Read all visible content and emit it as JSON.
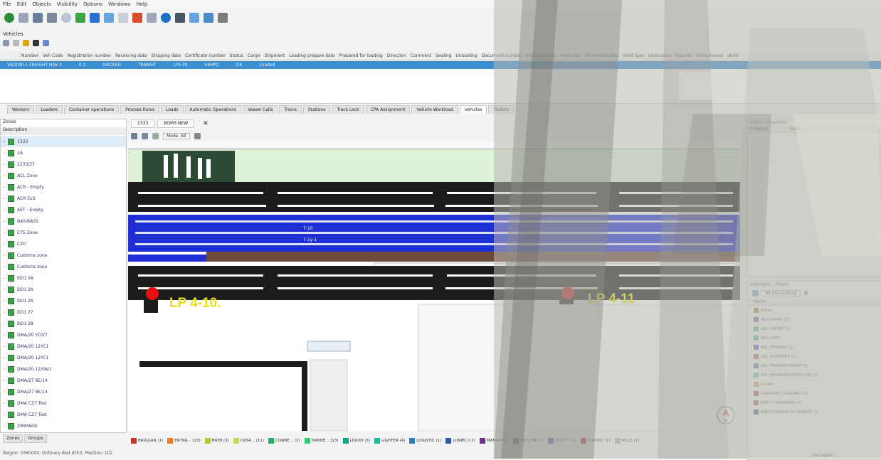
{
  "menu": [
    "File",
    "Edit",
    "Objects",
    "Visibility",
    "Options",
    "Windows",
    "Help"
  ],
  "vehicles": {
    "title": "Vehicles",
    "columns": [
      "Number",
      "Veh Code",
      "Registration number",
      "Receiving date",
      "Shipping date",
      "Certificate number",
      "Status",
      "Cargo",
      "Shipment",
      "Loading prepare date",
      "Prepared for loading",
      "Direction",
      "Comment",
      "Sealing",
      "Unloading",
      "Document number",
      "Hold intention",
      "Hold user",
      "Permission date",
      "Hold type",
      "Instruction",
      "Reports",
      "Performance",
      "Ident"
    ],
    "selected_row": [
      "VAGON11 FREIGHT HSK-3",
      "0.2",
      "DOCKED",
      "TRANSIT",
      "LPS Fit",
      "VIHIPO",
      "OK",
      "Loaded"
    ]
  },
  "tabs": [
    "Workers",
    "Loaders",
    "Container operations",
    "Process Rules",
    "Loads",
    "Automatic Operations",
    "Vessel Calls",
    "Trains",
    "Stations",
    "Track Lock",
    "CPA Assignment",
    "Vehicle Workload",
    "Vehicles",
    "Trailers"
  ],
  "zones": {
    "title": "Zones",
    "desc": "Description",
    "items": [
      "1333",
      "2A",
      "2233/27",
      "ACL Zone",
      "ACR - Empty",
      "ACR Exit",
      "AET - Empty",
      "BAS-BASS",
      "CTS Zone",
      "CZ0",
      "Customs zone",
      "Customs zone",
      "DD1 5A",
      "DD1 26",
      "DD1 26",
      "DD1 27",
      "DD1 28",
      "DMA/20 YC0/7",
      "DMA/20 12YC1",
      "DMA/20 12YC1",
      "DMA/20 12/0A/1",
      "DMA/27 8E/14",
      "DMA/27 8E/14",
      "DMA CZ7 Test",
      "DMA CZ7 Test",
      "ZIMMAGE"
    ],
    "bottom_tabs": [
      "Zones",
      "Groups"
    ]
  },
  "map": {
    "tabs": [
      "1333",
      "BOM3 NEW"
    ],
    "zoom": "Mode: All",
    "lp_left": "LP 4-10.",
    "lp_right": "LP 4-11",
    "lane_labels": [
      "7-10",
      "7-1y-1"
    ]
  },
  "legend": [
    {
      "label": "BRIGGAN (1)",
      "color": "#c0392b"
    },
    {
      "label": "ENTRA... (23)",
      "color": "#e67e22"
    },
    {
      "label": "BATH (3)",
      "color": "#b5c62d"
    },
    {
      "label": "CASA... (11)",
      "color": "#c8d850"
    },
    {
      "label": "CONNE... (2)",
      "color": "#27ae60"
    },
    {
      "label": "HANNE... (13)",
      "color": "#2ecc71"
    },
    {
      "label": "LIQUID (3)",
      "color": "#16a085"
    },
    {
      "label": "LIGHTER (4)",
      "color": "#1abc9c"
    },
    {
      "label": "LOGISTIC (1)",
      "color": "#2980b9"
    },
    {
      "label": "LONER (11)",
      "color": "#3458a8"
    },
    {
      "label": "MAMMA (1)",
      "color": "#6c3483"
    },
    {
      "label": "PROLINE (1)",
      "color": "#8e44ad"
    },
    {
      "label": "RIVETS (1)",
      "color": "#7d3c98"
    },
    {
      "label": "SHAPED (1)",
      "color": "#a93226"
    },
    {
      "label": "HILLS (1)",
      "color": "#b8b8b8"
    }
  ],
  "status": "Wagon: 3360000, Ordinary Bed ATEX, Position: 102",
  "object_properties": {
    "title": "Object Properties",
    "col1": "Property",
    "col2": "Value"
  },
  "highlights": {
    "title": "Highlights / Filters",
    "dropdown": "All (Ascending)",
    "name_header": "Name",
    "items": [
      {
        "label": "Zones",
        "color": "#8a6d1f"
      },
      {
        "label": "AEL FEAHV (1)",
        "color": "#6c3483"
      },
      {
        "label": "AEL IMPORT (1)",
        "color": "#27ae60"
      },
      {
        "label": "AEL CUIPT",
        "color": "#1abc9c"
      },
      {
        "label": "AEL SESSION (1)",
        "color": "#1f3a93"
      },
      {
        "label": "AEL SUBSPENT (1)",
        "color": "#c0392b"
      },
      {
        "label": "AEL TRANSSHIPMENT(6)",
        "color": "#3458a8"
      },
      {
        "label": "AEL TRANSSHIPMENT EXP (2)",
        "color": "#2ecc71"
      },
      {
        "label": "CHINA",
        "color": "#e67e22"
      },
      {
        "label": "DAMAGED_LOADING (1)",
        "color": "#922b21"
      },
      {
        "label": "EMPTY DAMAGED (1)",
        "color": "#a93226"
      },
      {
        "label": "EMPTY REPAIR IN TRANSIT (2)",
        "color": "#1f3a93"
      }
    ],
    "footer": "Damaged"
  },
  "colors": {
    "selection": "#3a8fd1",
    "lane_blue": "#1f2fd6",
    "zone_green": "#3fa048",
    "lp_yellow": "#e8e10a",
    "lp_red": "#e81010"
  }
}
